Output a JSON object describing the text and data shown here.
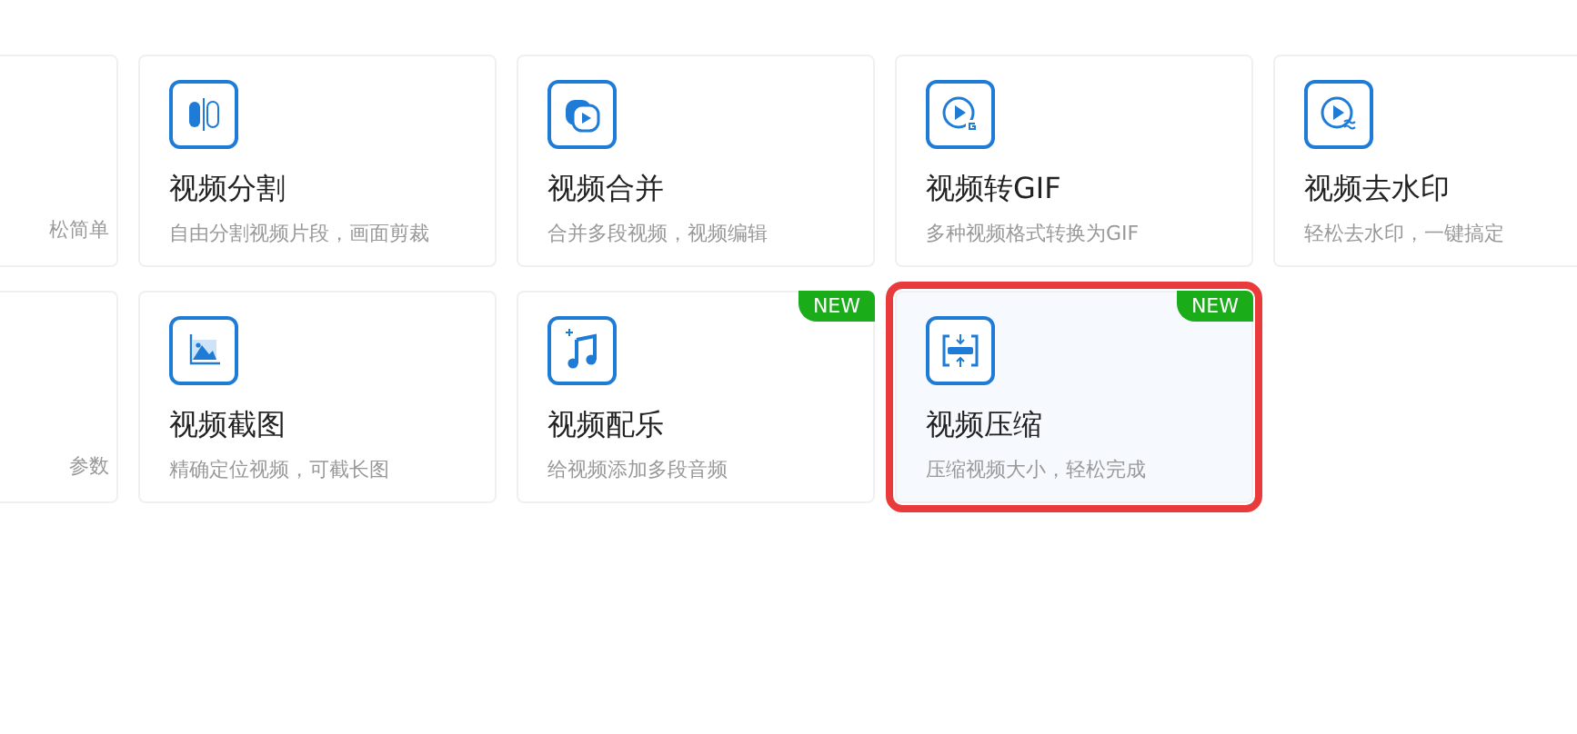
{
  "rows": [
    {
      "cards": [
        {
          "kind": "partial",
          "description": "松简单"
        },
        {
          "kind": "tool",
          "title": "视频分割",
          "description": "自由分割视频片段，画面剪裁",
          "new": false,
          "highlighted": false
        },
        {
          "kind": "tool",
          "title": "视频合并",
          "description": "合并多段视频，视频编辑",
          "new": false,
          "highlighted": false
        },
        {
          "kind": "tool",
          "title": "视频转GIF",
          "description": "多种视频格式转换为GIF",
          "new": false,
          "highlighted": false
        },
        {
          "kind": "tool",
          "title": "视频去水印",
          "description": "轻松去水印，一键搞定",
          "new": false,
          "highlighted": false
        }
      ]
    },
    {
      "cards": [
        {
          "kind": "partial",
          "description": "参数"
        },
        {
          "kind": "tool",
          "title": "视频截图",
          "description": "精确定位视频，可截长图",
          "new": false,
          "highlighted": false
        },
        {
          "kind": "tool",
          "title": "视频配乐",
          "description": "给视频添加多段音频",
          "new": true,
          "badge": "NEW",
          "highlighted": false
        },
        {
          "kind": "tool",
          "title": "视频压缩",
          "description": "压缩视频大小，轻松完成",
          "new": true,
          "badge": "NEW",
          "highlighted": true
        }
      ]
    }
  ]
}
